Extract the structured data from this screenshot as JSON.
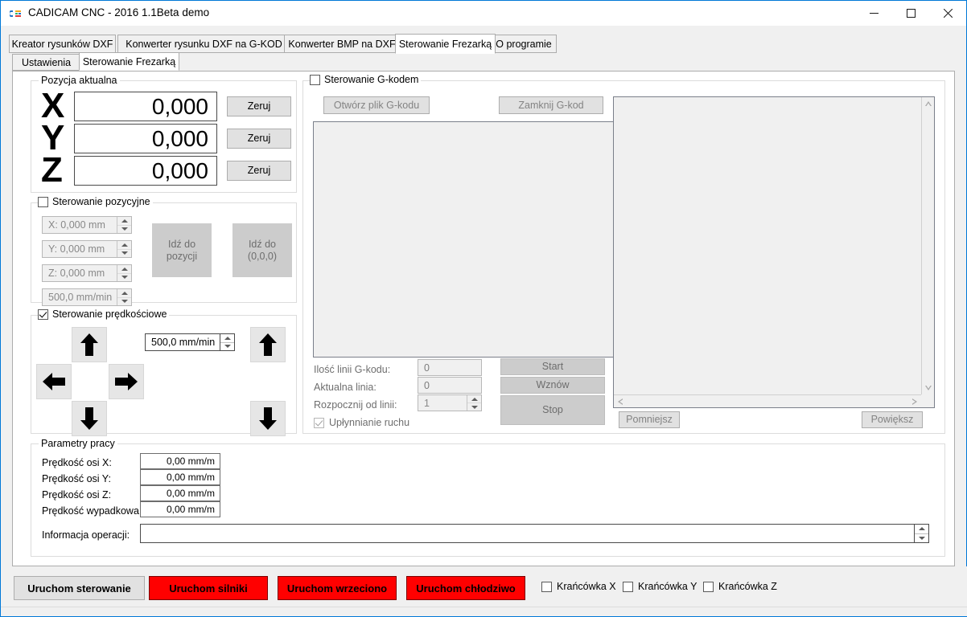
{
  "window": {
    "title": "CADICAM CNC - 2016 1.1Beta demo",
    "icon": "app-icon",
    "minimize": "minimize-icon",
    "maximize": "maximize-icon",
    "close": "close-icon"
  },
  "outer_tabs": [
    {
      "label": "Kreator rysunków DXF",
      "active": false
    },
    {
      "label": "Konwerter rysunku DXF na G-KOD",
      "active": false
    },
    {
      "label": "Konwerter BMP na DXF",
      "active": false
    },
    {
      "label": "Sterowanie Frezarką",
      "active": true
    },
    {
      "label": "O programie",
      "active": false
    }
  ],
  "inner_tabs": [
    {
      "label": "Ustawienia",
      "active": false
    },
    {
      "label": "Sterowanie Frezarką",
      "active": true
    }
  ],
  "position_group": {
    "title": "Pozycja aktualna",
    "axes": [
      {
        "letter": "X",
        "value": "0,000",
        "zero_label": "Zeruj"
      },
      {
        "letter": "Y",
        "value": "0,000",
        "zero_label": "Zeruj"
      },
      {
        "letter": "Z",
        "value": "0,000",
        "zero_label": "Zeruj"
      }
    ]
  },
  "position_control": {
    "title": "Sterowanie pozycyjne",
    "checked": false,
    "fields": [
      {
        "value": "X: 0,000 mm"
      },
      {
        "value": "Y: 0,000 mm"
      },
      {
        "value": "Z: 0,000 mm"
      },
      {
        "value": "500,0 mm/min"
      }
    ],
    "goto_position": "Idź do\npozycji",
    "goto_origin": "Idź do\n(0,0,0)"
  },
  "speed_control": {
    "title": "Sterowanie prędkościowe",
    "checked": true,
    "feed_value": "500,0 mm/min",
    "arrows": {
      "up": "arrow-up-icon",
      "down": "arrow-down-icon",
      "left": "arrow-left-icon",
      "right": "arrow-right-icon",
      "z_up": "arrow-up-icon",
      "z_down": "arrow-down-icon"
    }
  },
  "gcode_control": {
    "title": "Sterowanie G-kodem",
    "checked": false,
    "open_file": "Otwórz plik G-kodu",
    "close_file": "Zamknij G-kod",
    "gcode_text": "",
    "labels": {
      "line_count": "Ilość linii G-kodu:",
      "current_line": "Aktualna linia:",
      "start_from_line": "Rozpocznij od linii:",
      "smooth_motion": "Upłynnianie ruchu"
    },
    "values": {
      "line_count": "0",
      "current_line": "0",
      "start_from_line": "1",
      "smooth_motion_checked": true
    },
    "buttons": {
      "start": "Start",
      "resume": "Wznów",
      "stop": "Stop"
    }
  },
  "preview": {
    "zoom_out": "Pomniejsz",
    "zoom_in": "Powiększ"
  },
  "work_params": {
    "title": "Parametry pracy",
    "rows": [
      {
        "label": "Prędkość osi X:",
        "value": "0,00 mm/m"
      },
      {
        "label": "Prędkość osi Y:",
        "value": "0,00 mm/m"
      },
      {
        "label": "Prędkość osi Z:",
        "value": "0,00 mm/m"
      },
      {
        "label": "Prędkość wypadkowa:",
        "value": "0,00 mm/m"
      }
    ],
    "operation_info_label": "Informacja operacji:",
    "operation_info_value": ""
  },
  "bottom": {
    "buttons": [
      {
        "label": "Uruchom sterowanie",
        "style": "gray"
      },
      {
        "label": "Uruchom silniki",
        "style": "red"
      },
      {
        "label": "Uruchom wrzeciono",
        "style": "red"
      },
      {
        "label": "Uruchom chłodziwo",
        "style": "red"
      }
    ],
    "endstops": [
      {
        "label": "Krańcówka X",
        "checked": false
      },
      {
        "label": "Krańcówka Y",
        "checked": false
      },
      {
        "label": "Krańcówka Z",
        "checked": false
      }
    ]
  },
  "colors": {
    "accent": "#0078d7",
    "danger": "#ff0000",
    "face": "#f0f0f0"
  }
}
